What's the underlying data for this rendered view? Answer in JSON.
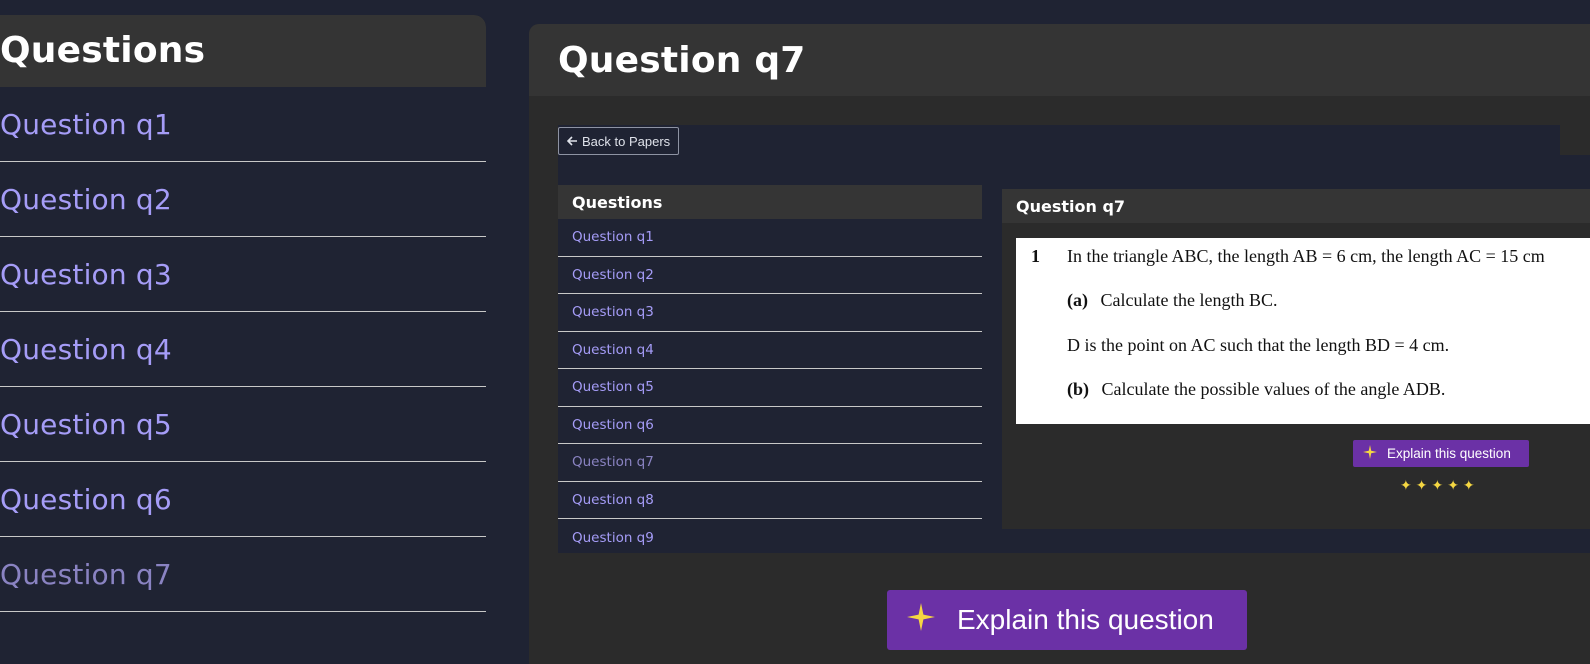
{
  "sidebar": {
    "title": "Questions",
    "items": [
      {
        "label": "Question q1"
      },
      {
        "label": "Question q2"
      },
      {
        "label": "Question q3"
      },
      {
        "label": "Question q4"
      },
      {
        "label": "Question q5"
      },
      {
        "label": "Question q6"
      },
      {
        "label": "Question q7"
      }
    ],
    "active_label": "Question q7"
  },
  "main": {
    "title": "Question q7",
    "back_button": "Back to Papers",
    "question_list": {
      "title": "Questions",
      "items": [
        {
          "label": "Question q1"
        },
        {
          "label": "Question q2"
        },
        {
          "label": "Question q3"
        },
        {
          "label": "Question q4"
        },
        {
          "label": "Question q5"
        },
        {
          "label": "Question q6"
        },
        {
          "label": "Question q7"
        },
        {
          "label": "Question q8"
        },
        {
          "label": "Question q9"
        }
      ]
    },
    "question_panel": {
      "title": "Question q7",
      "question_number": "1",
      "line1": "In the triangle ABC, the length AB = 6 cm, the length AC = 15 cm",
      "part_a_label": "(a)",
      "part_a_text": "Calculate the length BC.",
      "line3": "D is the point on AC such that the length BD = 4 cm.",
      "part_b_label": "(b)",
      "part_b_text": "Calculate the possible values of the angle ADB."
    },
    "explain_button_small": "Explain this question",
    "explain_button_large": "Explain this question",
    "sparkles": "✦✦✦✦✦"
  },
  "colors": {
    "background": "#1f2333",
    "panel": "#2b2b2b",
    "header": "#343434",
    "link": "#a59cf7",
    "active_link": "#8a83c2",
    "accent": "#6b31a6",
    "sparkle": "#f5d742"
  },
  "icons": {
    "back": "arrow-left-icon",
    "explain": "sparkle-icon"
  }
}
